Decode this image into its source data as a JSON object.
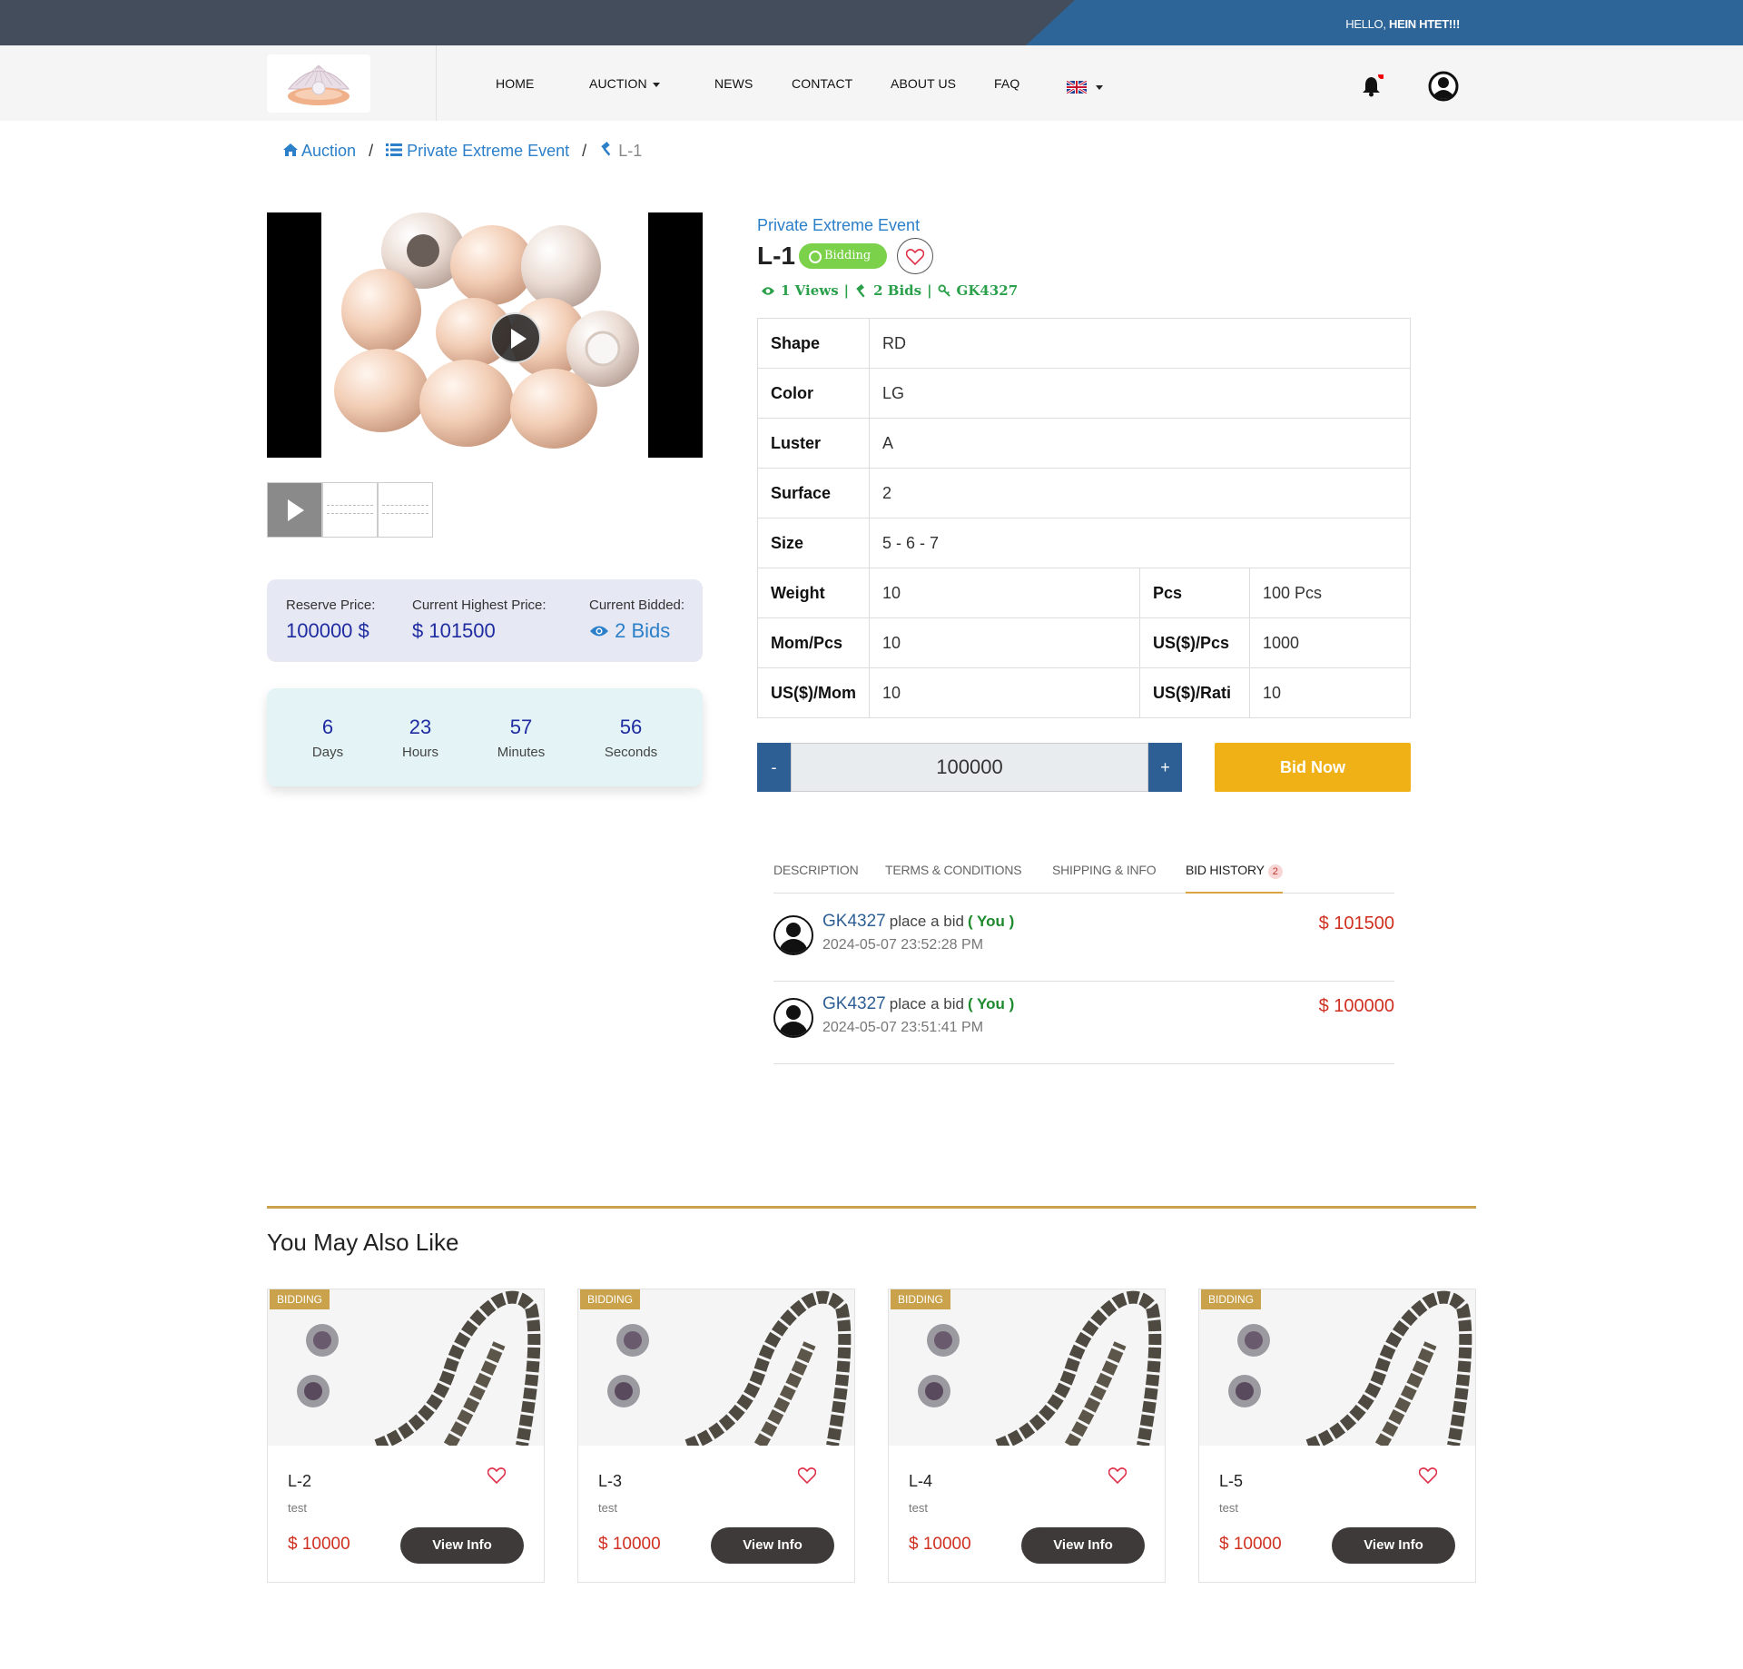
{
  "topbar": {
    "greeting": "HELLO,",
    "username": "HEIN HTET!!!"
  },
  "nav": {
    "items": [
      "HOME",
      "AUCTION",
      "NEWS",
      "CONTACT",
      "ABOUT US",
      "FAQ"
    ],
    "icons": [
      "bell-icon",
      "user-icon",
      "uk-flag-icon"
    ]
  },
  "breadcrumb": {
    "home": "Auction",
    "event": "Private Extreme Event",
    "current": "L-1"
  },
  "price": {
    "reserve_label": "Reserve Price:",
    "reserve_value": "100000 $",
    "highest_label": "Current Highest Price:",
    "highest_value": "$ 101500",
    "bidded_label": "Current Bidded:",
    "bidded_value": "2 Bids"
  },
  "countdown": {
    "days": "6",
    "days_label": "Days",
    "hours": "23",
    "hours_label": "Hours",
    "minutes": "57",
    "minutes_label": "Minutes",
    "seconds": "56",
    "seconds_label": "Seconds"
  },
  "lot": {
    "event": "Private Extreme Event",
    "title": "L-1",
    "status": "Bidding",
    "views": "1 Views",
    "bids": "2 Bids",
    "bidder": "GK4327"
  },
  "specs": {
    "shape_label": "Shape",
    "shape": "RD",
    "color_label": "Color",
    "color": "LG",
    "luster_label": "Luster",
    "luster": "A",
    "surface_label": "Surface",
    "surface": "2",
    "size_label": "Size",
    "size": "5 - 6 - 7",
    "weight_label": "Weight",
    "weight": "10",
    "pcs_label": "Pcs",
    "pcs": "100 Pcs",
    "mompcs_label": "Mom/Pcs",
    "mompcs": "10",
    "uspcs_label": "US($)/Pcs",
    "uspcs": "1000",
    "usmom_label": "US($)/Mom",
    "usmom": "10",
    "usrati_label": "US($)/Rati",
    "usrati": "10"
  },
  "bid": {
    "minus": "-",
    "value": "100000",
    "plus": "+",
    "submit": "Bid Now"
  },
  "tabs": {
    "description": "DESCRIPTION",
    "terms": "TERMS & CONDITIONS",
    "shipping": "SHIPPING & INFO",
    "history": "BID HISTORY",
    "history_count": "2"
  },
  "history": [
    {
      "user": "GK4327",
      "action": "place a bid",
      "you": "( You )",
      "time": "2024-05-07 23:52:28 PM",
      "amount": "$ 101500"
    },
    {
      "user": "GK4327",
      "action": "place a bid",
      "you": "( You )",
      "time": "2024-05-07 23:51:41 PM",
      "amount": "$ 100000"
    }
  ],
  "related": {
    "title": "You May Also Like",
    "cards": [
      {
        "tag": "BIDDING",
        "name": "L-2",
        "desc": "test",
        "price": "$ 10000",
        "button": "View Info"
      },
      {
        "tag": "BIDDING",
        "name": "L-3",
        "desc": "test",
        "price": "$ 10000",
        "button": "View Info"
      },
      {
        "tag": "BIDDING",
        "name": "L-4",
        "desc": "test",
        "price": "$ 10000",
        "button": "View Info"
      },
      {
        "tag": "BIDDING",
        "name": "L-5",
        "desc": "test",
        "price": "$ 10000",
        "button": "View Info"
      }
    ]
  },
  "colors": {
    "accent_blue": "#2d6599",
    "gold": "#c9a24b",
    "bid_yellow": "#efb116",
    "price_red": "#d03020",
    "status_green": "#7bd24a"
  }
}
